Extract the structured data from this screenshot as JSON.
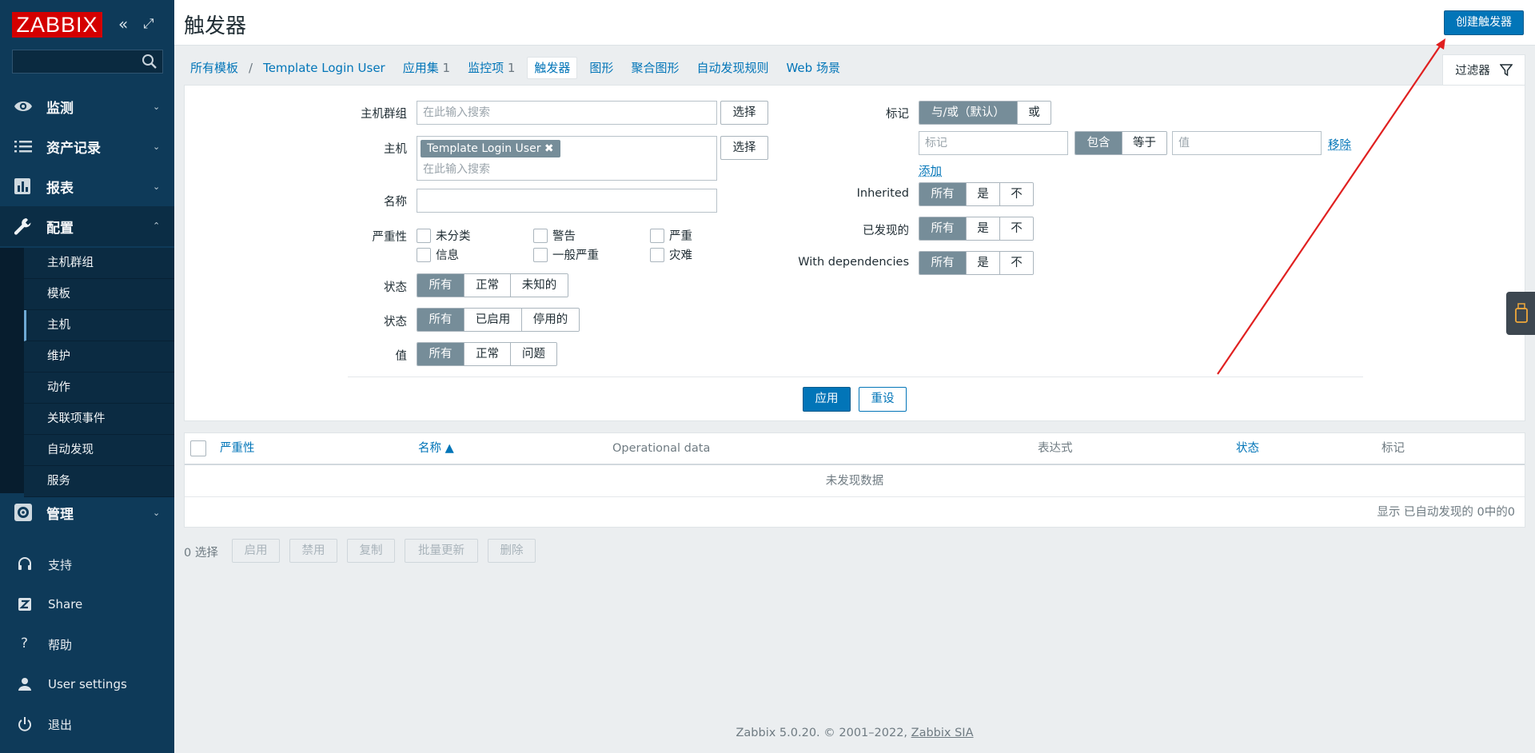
{
  "app": {
    "logo": "ZABBIX",
    "title": "触发器",
    "create_button": "创建触发器"
  },
  "sidebar": {
    "collapse_icon": "«",
    "kiosk_icon": "⤢",
    "search_placeholder": "",
    "top_menu": [
      {
        "label": "监测",
        "icon": "eye-icon"
      },
      {
        "label": "资产记录",
        "icon": "list-icon"
      },
      {
        "label": "报表",
        "icon": "chart-icon"
      },
      {
        "label": "配置",
        "icon": "wrench-icon"
      },
      {
        "label": "管理",
        "icon": "gear-icon"
      }
    ],
    "config_submenu": [
      "主机群组",
      "模板",
      "主机",
      "维护",
      "动作",
      "关联项事件",
      "自动发现",
      "服务"
    ],
    "selected_submenu": "主机",
    "bottom_menu": [
      {
        "label": "支持",
        "icon": "headset-icon"
      },
      {
        "label": "Share",
        "icon": "share-icon"
      },
      {
        "label": "帮助",
        "icon": "help-icon"
      },
      {
        "label": "User settings",
        "icon": "user-icon"
      },
      {
        "label": "退出",
        "icon": "power-icon"
      }
    ]
  },
  "breadcrumb": {
    "root": "所有模板",
    "separator": "/",
    "template": "Template Login User",
    "tabs": [
      {
        "label": "应用集",
        "count": "1"
      },
      {
        "label": "监控项",
        "count": "1"
      },
      {
        "label": "触发器",
        "count": ""
      },
      {
        "label": "图形",
        "count": ""
      },
      {
        "label": "聚合图形",
        "count": ""
      },
      {
        "label": "自动发现规则",
        "count": ""
      },
      {
        "label": "Web 场景",
        "count": ""
      }
    ],
    "active_tab": "触发器"
  },
  "filter": {
    "tab_label": "过滤器",
    "labels": {
      "host_group": "主机群组",
      "host": "主机",
      "name": "名称",
      "severity": "严重性",
      "state": "状态",
      "status": "状态",
      "value": "值",
      "tags": "标记",
      "inherited": "Inherited",
      "discovered": "已发现的",
      "with_dependencies": "With dependencies"
    },
    "host_group_placeholder": "在此输入搜索",
    "select_button": "选择",
    "host_tag": "Template Login User",
    "host_tag_remove": "✖",
    "host_placeholder": "在此输入搜索",
    "name_value": "",
    "severity_options": [
      "未分类",
      "警告",
      "严重",
      "信息",
      "一般严重",
      "灾难"
    ],
    "state_options": [
      "所有",
      "正常",
      "未知的"
    ],
    "status_options": [
      "所有",
      "已启用",
      "停用的"
    ],
    "value_options": [
      "所有",
      "正常",
      "问题"
    ],
    "tag_mode_options": [
      "与/或（默认）",
      "或"
    ],
    "tag_placeholder": "标记",
    "tag_operator_options": [
      "包含",
      "等于"
    ],
    "tag_value_placeholder": "值",
    "remove_link": "移除",
    "add_link": "添加",
    "tri_options": [
      "所有",
      "是",
      "不"
    ],
    "apply_button": "应用",
    "reset_button": "重设"
  },
  "table": {
    "columns": [
      "严重性",
      "名称 ▲",
      "Operational data",
      "表达式",
      "状态",
      "标记"
    ],
    "empty_text": "未发现数据",
    "paging_text": "显示 已自动发现的 0中的0"
  },
  "actions": {
    "selected": "0 选择",
    "buttons": [
      "启用",
      "禁用",
      "复制",
      "批量更新",
      "删除"
    ]
  },
  "footer": {
    "text": "Zabbix 5.0.20. © 2001–2022,",
    "link": "Zabbix SIA"
  },
  "colors": {
    "sidebar": "#0e3a59",
    "primary": "#0275b8",
    "logo": "#d40000",
    "segment_active": "#768d99"
  }
}
